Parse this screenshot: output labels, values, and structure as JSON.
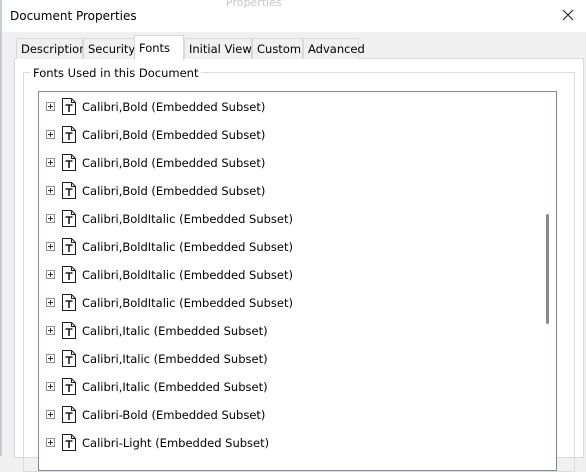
{
  "window": {
    "title": "Document Properties",
    "title_behind": "Properties"
  },
  "tabs": [
    {
      "label": "Description",
      "active": false
    },
    {
      "label": "Security",
      "active": false
    },
    {
      "label": "Fonts",
      "active": true
    },
    {
      "label": "Initial View",
      "active": false
    },
    {
      "label": "Custom",
      "active": false
    },
    {
      "label": "Advanced",
      "active": false
    }
  ],
  "fonts_group": {
    "label": "Fonts Used in this Document",
    "items": [
      {
        "label": "Calibri,Bold (Embedded Subset)",
        "icon": "truetype-font-icon"
      },
      {
        "label": "Calibri,Bold (Embedded Subset)",
        "icon": "truetype-font-icon"
      },
      {
        "label": "Calibri,Bold (Embedded Subset)",
        "icon": "truetype-font-icon"
      },
      {
        "label": "Calibri,Bold (Embedded Subset)",
        "icon": "truetype-font-icon"
      },
      {
        "label": "Calibri,BoldItalic (Embedded Subset)",
        "icon": "truetype-font-icon"
      },
      {
        "label": "Calibri,BoldItalic (Embedded Subset)",
        "icon": "truetype-font-icon"
      },
      {
        "label": "Calibri,BoldItalic (Embedded Subset)",
        "icon": "truetype-font-icon"
      },
      {
        "label": "Calibri,BoldItalic (Embedded Subset)",
        "icon": "truetype-font-icon"
      },
      {
        "label": "Calibri,Italic (Embedded Subset)",
        "icon": "truetype-font-icon"
      },
      {
        "label": "Calibri,Italic (Embedded Subset)",
        "icon": "truetype-font-icon"
      },
      {
        "label": "Calibri,Italic (Embedded Subset)",
        "icon": "truetype-font-icon"
      },
      {
        "label": "Calibri-Bold (Embedded Subset)",
        "icon": "truetype-font-icon"
      },
      {
        "label": "Calibri-Light (Embedded Subset)",
        "icon": "truetype-font-icon"
      }
    ]
  },
  "colors": {
    "accent_border": "#828790",
    "icon_stroke": "#1e1e1e"
  }
}
